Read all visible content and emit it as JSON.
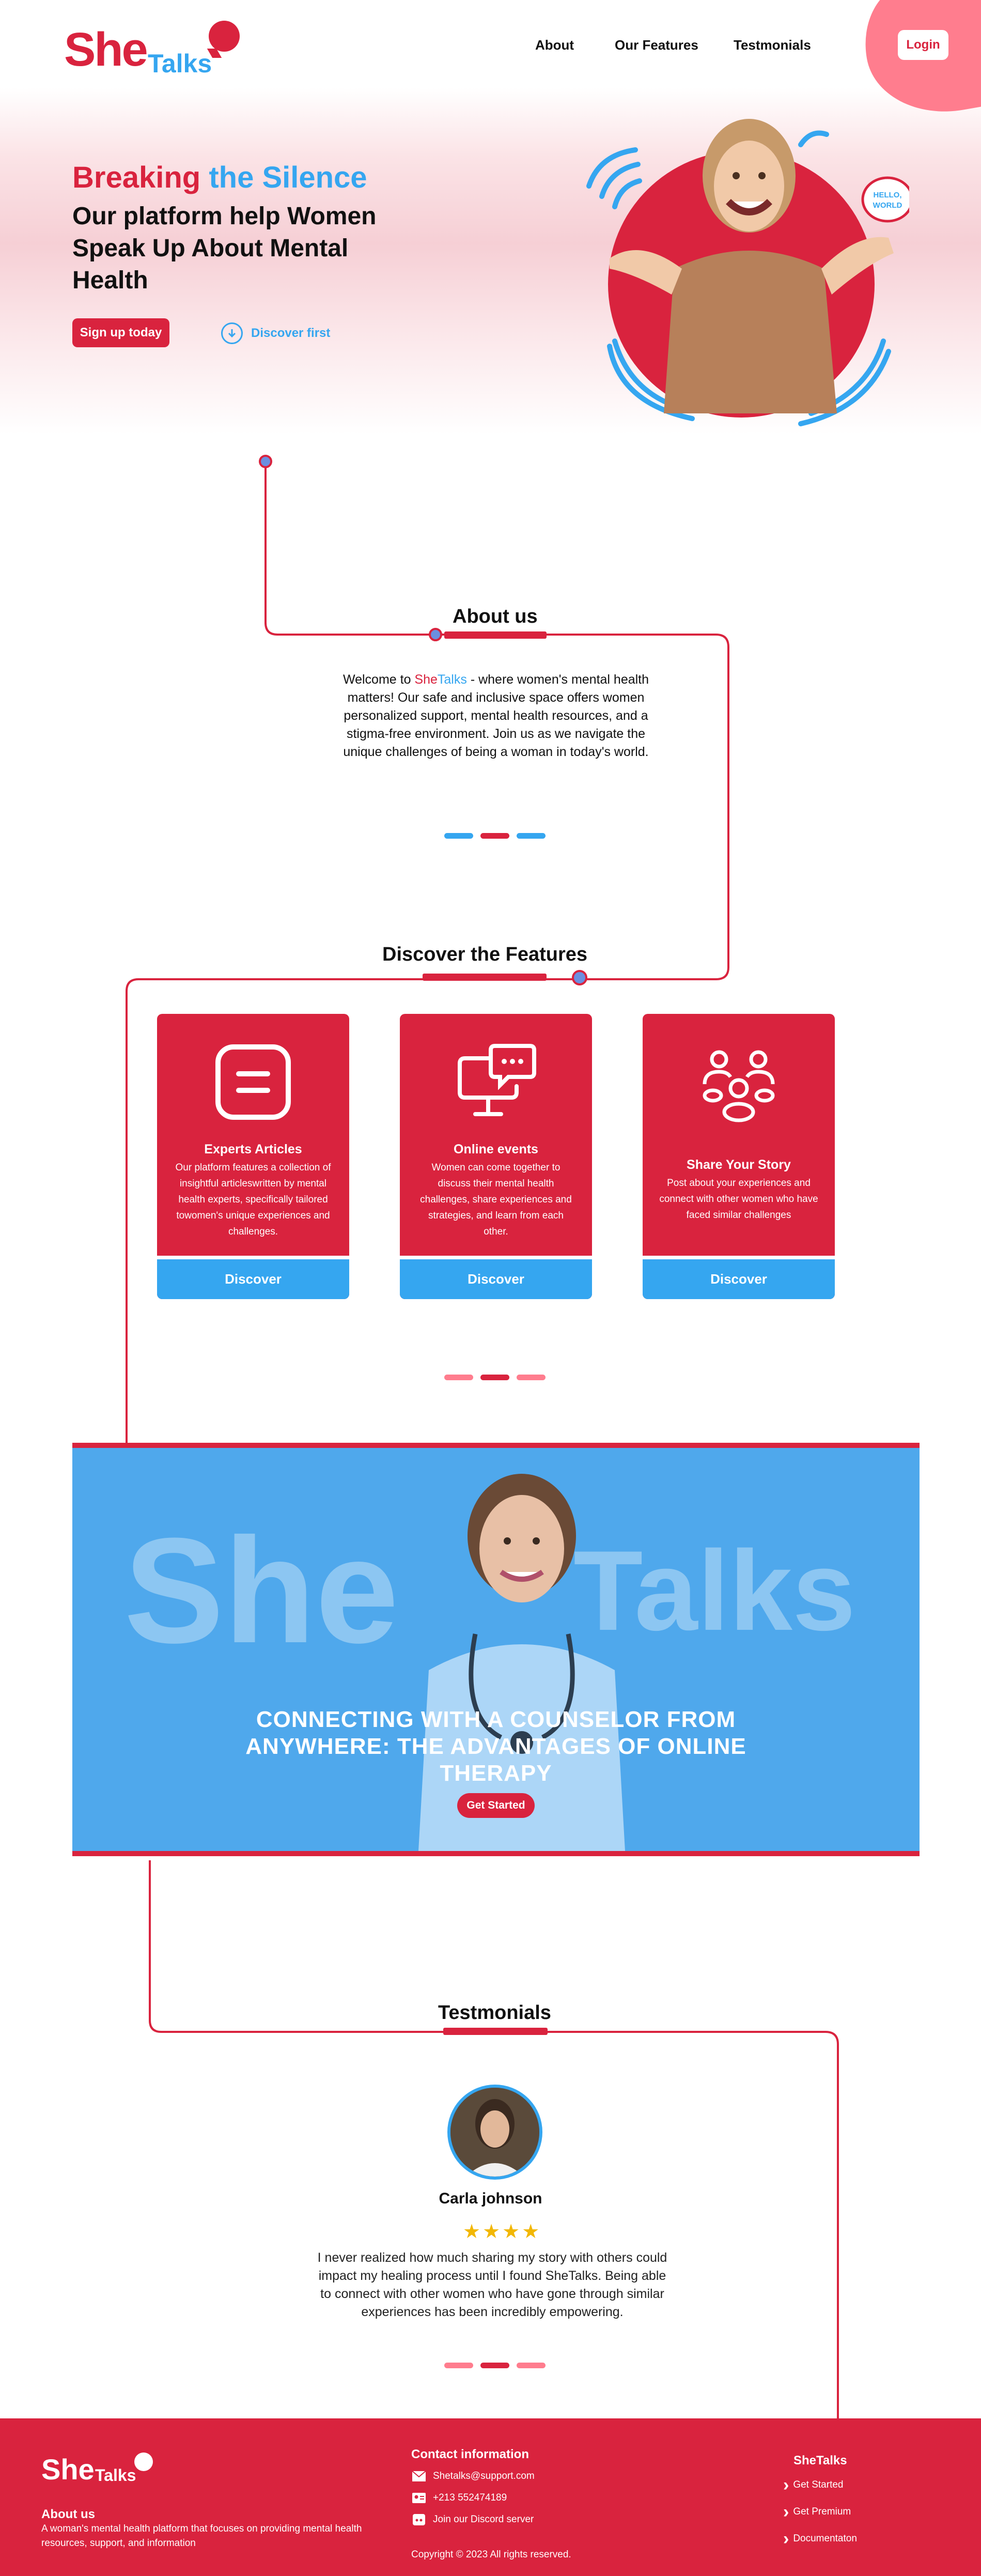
{
  "brand": {
    "she": "She",
    "talks": "Talks"
  },
  "nav": {
    "about": "About",
    "features": "Our Features",
    "testimonials": "Testmonials",
    "login": "Login"
  },
  "hero": {
    "title_red": "Breaking",
    "title_blue": "the Silence",
    "subtitle": "Our platform help Women Speak Up About Mental Health",
    "signup": "Sign up today",
    "discover": "Discover first",
    "bubble_text": "HELLO, WORLD"
  },
  "about": {
    "title": "About us",
    "text_before": "Welcome to ",
    "text_she": "She",
    "text_talks": "Talks",
    "text_after": " - where women's mental health matters! Our safe and inclusive space offers women personalized support, mental health resources, and a stigma-free environment. Join us as we navigate the unique challenges of being a woman in today's world."
  },
  "features": {
    "title": "Discover the Features",
    "cards": [
      {
        "title": "Experts Articles",
        "desc": "Our platform features a collection of insightful articleswritten by mental health experts, specifically tailored towomen's unique experiences and challenges.",
        "button": "Discover",
        "icon": "article-icon"
      },
      {
        "title": "Online events",
        "desc": "Women can come together to discuss their mental health challenges, share experiences and strategies, and learn from each other.",
        "button": "Discover",
        "icon": "chat-monitor-icon"
      },
      {
        "title": "Share Your Story",
        "desc": "Post about your experiences and connect with other women who have faced similar challenges",
        "button": "Discover",
        "icon": "community-icon"
      }
    ]
  },
  "banner": {
    "bg_she": "She",
    "bg_talks": "Talks",
    "heading": "CONNECTING WITH A COUNSELOR FROM ANYWHERE: THE ADVANTAGES OF ONLINE THERAPY",
    "button": "Get Started"
  },
  "testimonials": {
    "title": "Testmonials",
    "name": "Carla johnson",
    "stars": "★★★★",
    "quote": "I never realized how much sharing my story with others could impact my healing process until I found SheTalks. Being able to connect with other women who have gone through similar experiences has been incredibly empowering."
  },
  "footer": {
    "about_title": "About us",
    "about_text": "A woman's mental health platform that focuses on providing mental health resources, support, and information",
    "contact_title": "Contact information",
    "email": "Shetalks@support.com",
    "phone": "+213 552474189",
    "discord": "Join our Discord server",
    "copyright": "Copyright © 2023 All rights reserved.",
    "links_title": "SheTalks",
    "links": [
      "Get Started",
      "Get Premium",
      "Documentaton"
    ]
  },
  "colors": {
    "red": "#D9233E",
    "blue": "#35A6F0",
    "pink": "#FF7D8E"
  }
}
